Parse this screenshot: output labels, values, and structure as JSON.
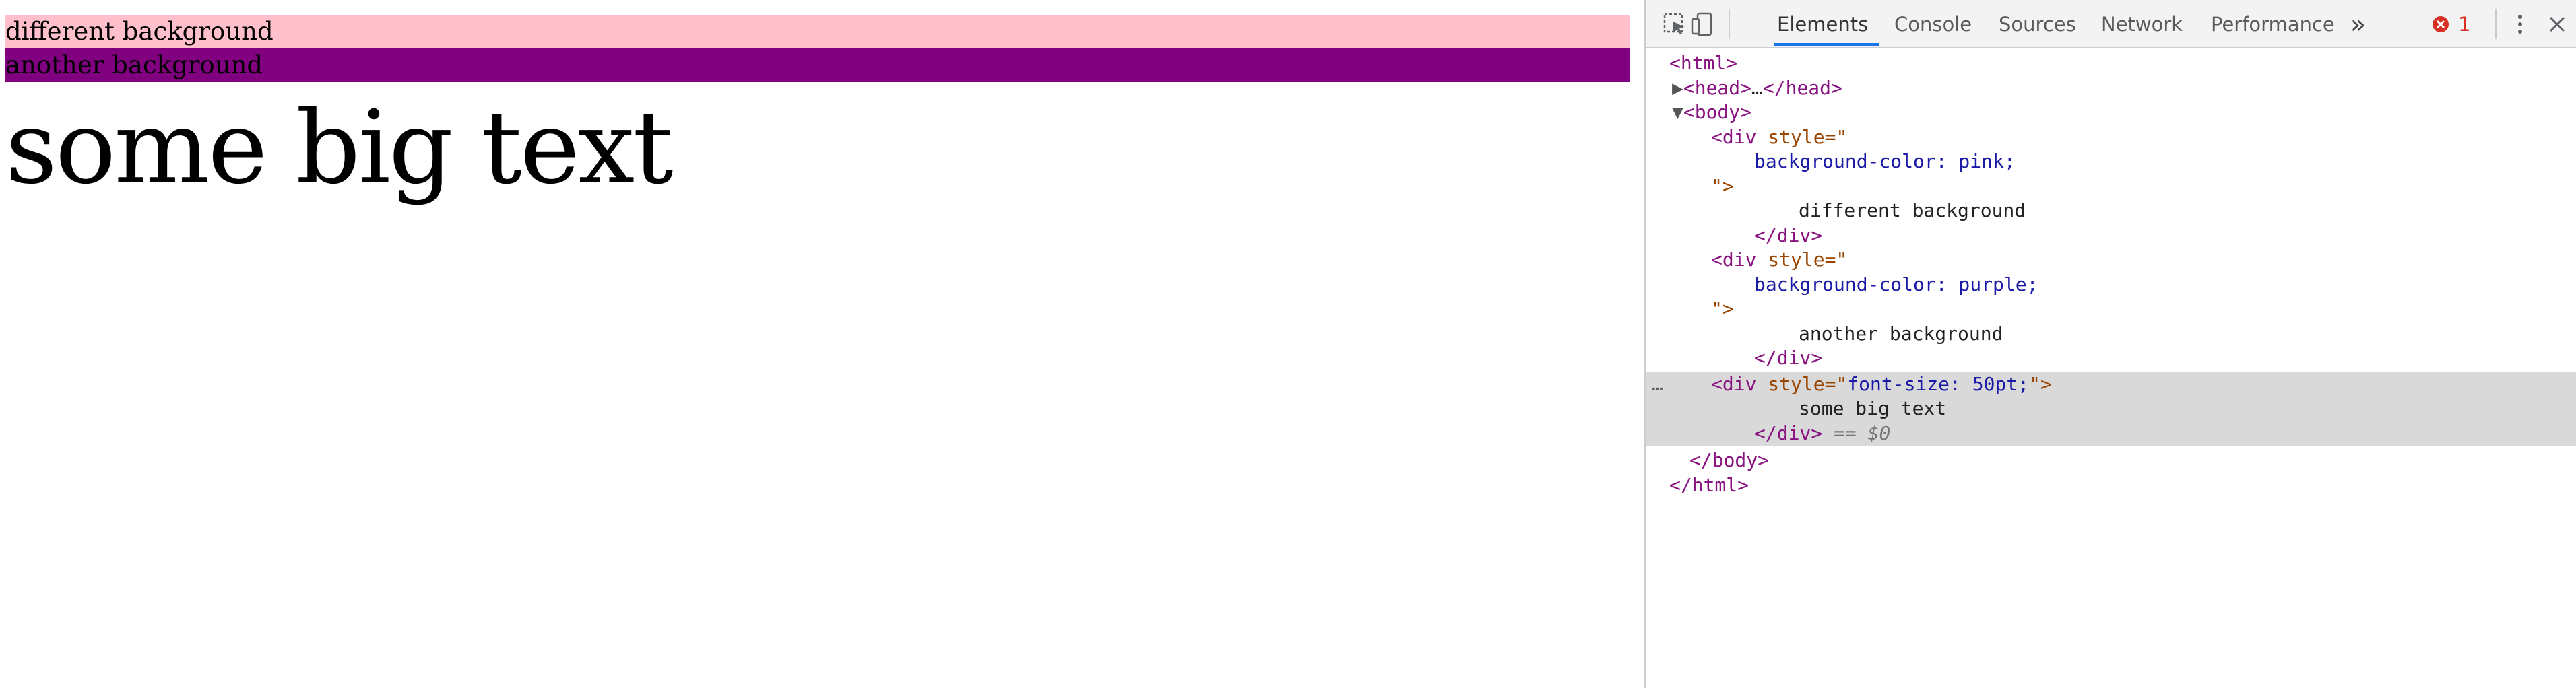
{
  "page": {
    "div1_text": "different background",
    "div1_color": "#ffc0cb",
    "div2_text": "another background",
    "div2_color": "#800080",
    "div3_text": "some big text"
  },
  "devtools": {
    "tabs": [
      "Elements",
      "Console",
      "Sources",
      "Network",
      "Performance"
    ],
    "active_tab": "Elements",
    "more_tabs_glyph": "»",
    "error_count": "1",
    "accent_color": "#1a73e8",
    "dom": {
      "html_open": "<html>",
      "head_open": "<head>",
      "head_ellipsis": "…",
      "head_close": "</head>",
      "body_open": "<body>",
      "div_open": "<div",
      "style_attr": "style",
      "eq_quote": "=\"",
      "quote": "\"",
      "close_quote_gt": "\">",
      "div1_style": "background-color: pink;",
      "div1_text": "different background",
      "div_close": "</div>",
      "div2_style": "background-color: purple;",
      "div2_text": "another background",
      "div3_style": "font-size: 50pt;",
      "div3_text": "some big text",
      "selected_marker": "== $0",
      "row_dots": "…",
      "body_close": "</body>",
      "html_close": "</html>"
    }
  }
}
